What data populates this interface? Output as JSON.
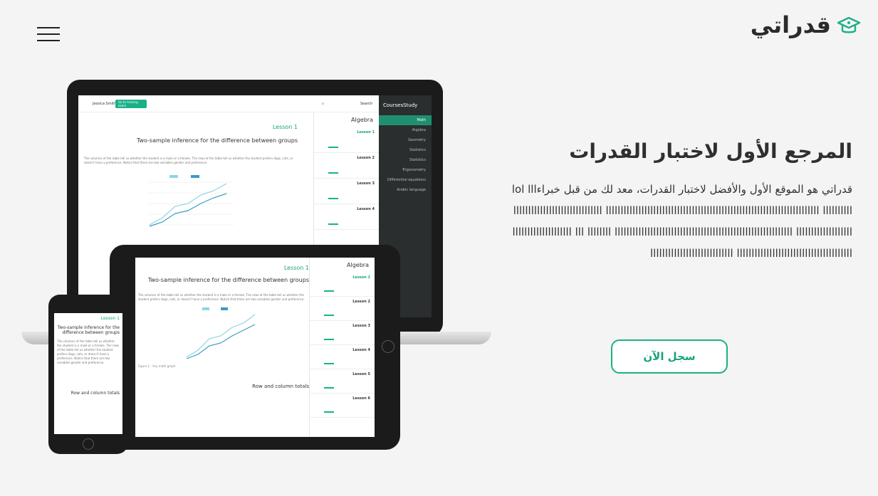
{
  "header": {
    "logo_text": "قدراتي",
    "menu_icon": "hamburger-menu-icon"
  },
  "hero": {
    "title": "المرجع الأول لاختبار القدرات",
    "description": "قدراتي هو الموقع الأول والأفضل لاختبار القدرات، معد لك من قبل خبراءlol lllllllllllllllllllllllllllllllll llllllllllllllllllllllllllllllllllllllllllllllllllllllllllllllllllllllll llllllllllllllllllllllllllllll lll llllllll llllllllllllllllllllllllllllllllllllllllllllllllllllllllllll lllllllllllllllllllllllllllllllllllllllllllllll lllllllllllllllllllllllllllllllllllllll"
  },
  "cta": {
    "label": "سجل الآن"
  },
  "mockup": {
    "brand": "CoursesStudy",
    "user": "Jessica Smith",
    "go_button": "Go to training exam",
    "search_placeholder": "Search",
    "subject": "Algebra",
    "lesson_title": "Lesson 1",
    "heading": "Two-sample inference for the difference between groups",
    "paragraph": "The columns of the table tell us whether the student is a male or a female. The rows of the table tell us whether the student prefers dogs, cats, or doesn't have a preference. Notice that there are two variables gender and preference.",
    "section2": "Row and column totals",
    "figure_caption": "Figure 1 - Any math graph",
    "lessons": [
      "Lesson 1",
      "Lesson 2",
      "Lesson 3",
      "Lesson 4",
      "Lesson 5",
      "Lesson 6"
    ],
    "lesson_sub": "Introduction to the course",
    "sidebar": [
      "Math",
      "Algebra",
      "Geometry",
      "Statistics",
      "Statistics",
      "Trigonometry",
      "Differential equations",
      "Arabic language"
    ],
    "colors": {
      "accent": "#1bb088",
      "dark": "#2a2e2e"
    }
  }
}
